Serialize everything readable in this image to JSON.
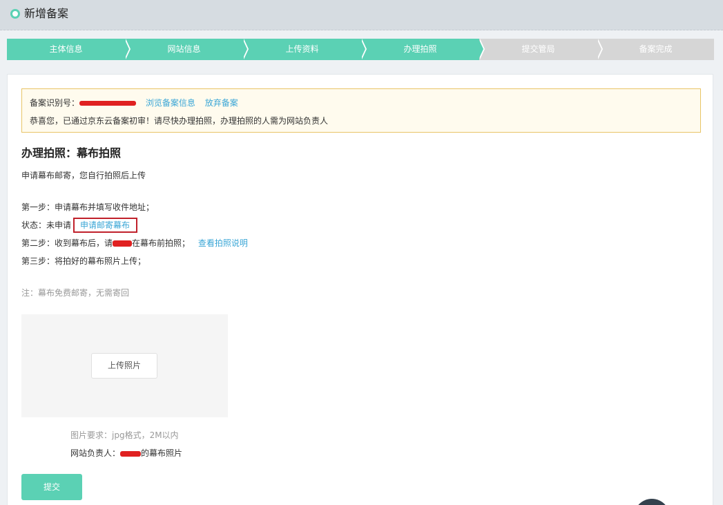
{
  "header": {
    "title": "新增备案"
  },
  "steps": [
    {
      "label": "主体信息",
      "done": true
    },
    {
      "label": "网站信息",
      "done": true
    },
    {
      "label": "上传资料",
      "done": true
    },
    {
      "label": "办理拍照",
      "done": true
    },
    {
      "label": "提交管局",
      "done": false
    },
    {
      "label": "备案完成",
      "done": false
    }
  ],
  "notice": {
    "id_label": "备案识别号：",
    "browse_link": "浏览备案信息",
    "abandon_link": "放弃备案",
    "message": "恭喜您，已通过京东云备案初审！请尽快办理拍照，办理拍照的人需为网站负责人"
  },
  "section": {
    "title": "办理拍照：幕布拍照",
    "subtitle": "申请幕布邮寄，您自行拍照后上传",
    "step1": "第一步：申请幕布并填写收件地址；",
    "status_label": "状态：未申请",
    "apply_button": "申请邮寄幕布",
    "step2_prefix": "第二步：收到幕布后，请",
    "step2_suffix": "在幕布前拍照；",
    "step2_link": "查看拍照说明",
    "step3": "第三步：将拍好的幕布照片上传；",
    "note": "注：幕布免费邮寄，无需寄回"
  },
  "upload": {
    "button_label": "上传照片",
    "requirement": "图片要求：jpg格式，2M以内",
    "owner_prefix": "网站负责人：",
    "owner_suffix": "的幕布照片"
  },
  "submit_label": "提交",
  "colors": {
    "accent": "#5bd1b4",
    "link": "#3aa6d6",
    "highlight_border": "#c0202a",
    "redaction": "#e02121"
  }
}
